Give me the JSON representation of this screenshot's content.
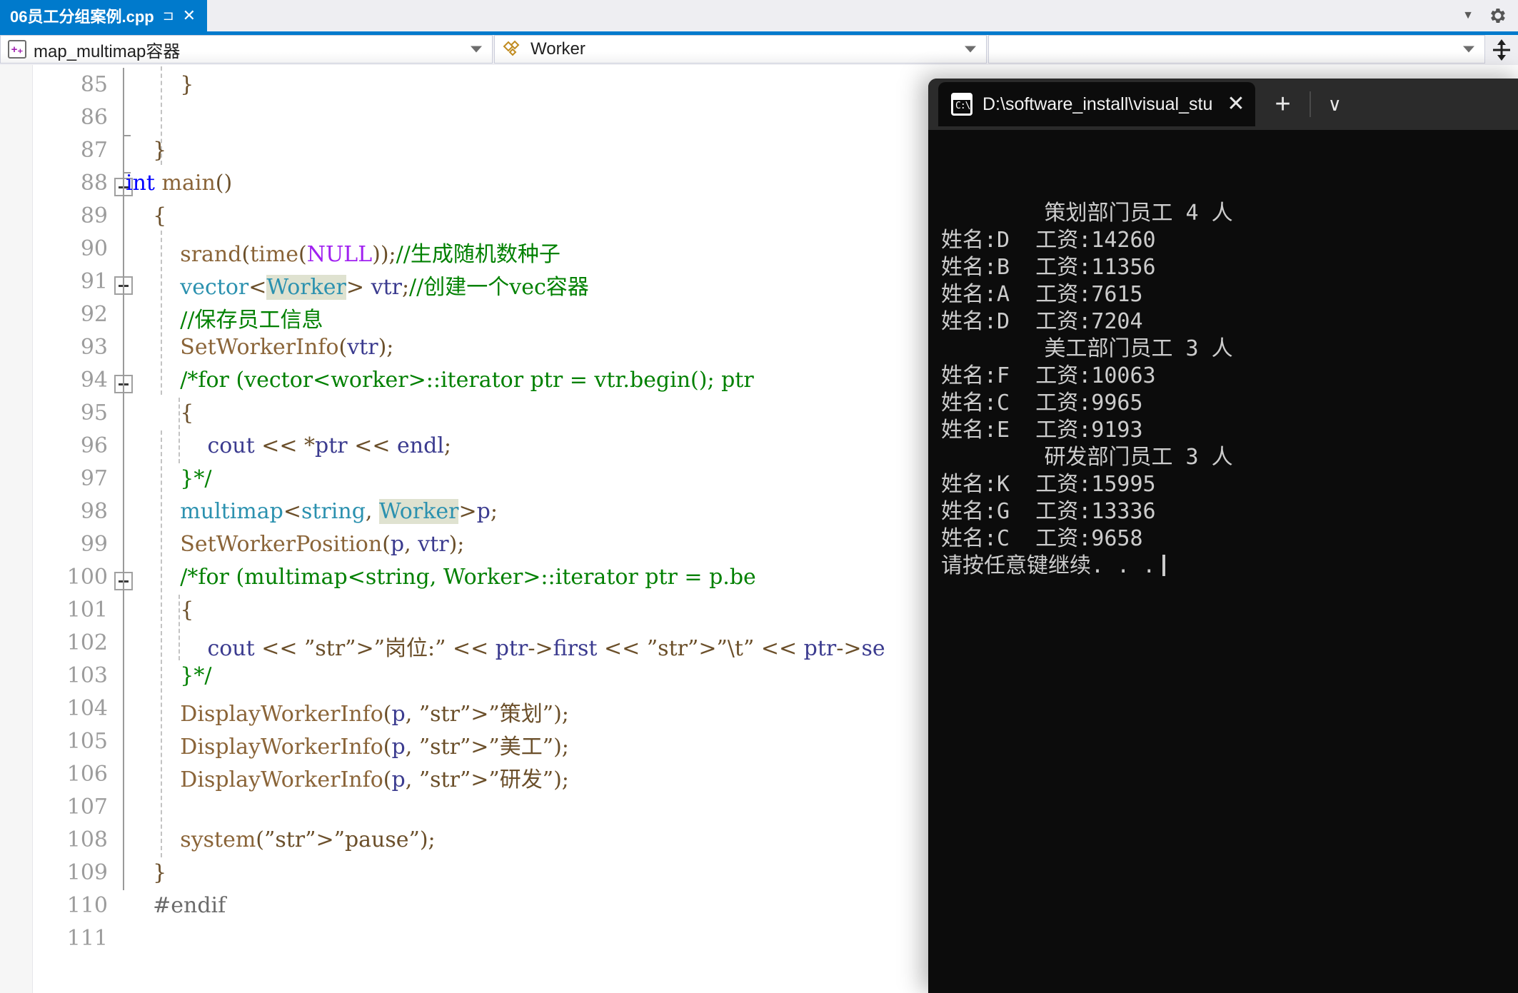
{
  "window": {
    "tab": {
      "title": "06员工分组案例.cpp",
      "pin_glyph": "⊐",
      "close_glyph": "✕"
    },
    "tabstrip_right": {
      "overflow_caret": "▼",
      "settings_icon": "gear-icon"
    }
  },
  "navbar": {
    "scope": {
      "icon": "cpp-file-icon",
      "icon_text": "+₊",
      "value": "map_multimap容器",
      "caret": "▼"
    },
    "member": {
      "icon": "class-icon",
      "value": "Worker",
      "caret": "▼"
    },
    "third": {
      "value": "",
      "caret": "▼"
    },
    "splitter": "split-editor-icon"
  },
  "editor": {
    "first_line": 85,
    "lines": [
      {
        "n": 85,
        "indent": 0,
        "text": "        }"
      },
      {
        "n": 86,
        "indent": 0,
        "text": ""
      },
      {
        "n": 87,
        "indent": 0,
        "text": "    }"
      },
      {
        "n": 88,
        "indent": 0,
        "text": "int main()"
      },
      {
        "n": 89,
        "indent": 0,
        "text": "    {"
      },
      {
        "n": 90,
        "indent": 0,
        "text": "        srand(time(NULL));//生成随机数种子"
      },
      {
        "n": 91,
        "indent": 0,
        "text": "        vector<Worker> vtr;//创建一个vec容器"
      },
      {
        "n": 92,
        "indent": 0,
        "text": "        //保存员工信息"
      },
      {
        "n": 93,
        "indent": 0,
        "text": "        SetWorkerInfo(vtr);"
      },
      {
        "n": 94,
        "indent": 0,
        "text": "        /*for (vector<worker>::iterator ptr = vtr.begin(); ptr"
      },
      {
        "n": 95,
        "indent": 0,
        "text": "        {"
      },
      {
        "n": 96,
        "indent": 0,
        "text": "            cout << *ptr << endl;"
      },
      {
        "n": 97,
        "indent": 0,
        "text": "        }*/"
      },
      {
        "n": 98,
        "indent": 0,
        "text": "        multimap<string, Worker>p;"
      },
      {
        "n": 99,
        "indent": 0,
        "text": "        SetWorkerPosition(p, vtr);"
      },
      {
        "n": 100,
        "indent": 0,
        "text": "        /*for (multimap<string, Worker>::iterator ptr = p.be"
      },
      {
        "n": 101,
        "indent": 0,
        "text": "        {"
      },
      {
        "n": 102,
        "indent": 0,
        "text": "            cout << \"岗位:\" << ptr->first << \"\\t\" << ptr->se"
      },
      {
        "n": 103,
        "indent": 0,
        "text": "        }*/"
      },
      {
        "n": 104,
        "indent": 0,
        "text": "        DisplayWorkerInfo(p, \"策划\");"
      },
      {
        "n": 105,
        "indent": 0,
        "text": "        DisplayWorkerInfo(p, \"美工\");"
      },
      {
        "n": 106,
        "indent": 0,
        "text": "        DisplayWorkerInfo(p, \"研发\");"
      },
      {
        "n": 107,
        "indent": 0,
        "text": ""
      },
      {
        "n": 108,
        "indent": 0,
        "text": "        system(\"pause\");"
      },
      {
        "n": 109,
        "indent": 0,
        "text": "    }"
      },
      {
        "n": 110,
        "indent": 0,
        "text": "    #endif"
      },
      {
        "n": 111,
        "indent": 0,
        "text": ""
      }
    ],
    "colors": {
      "keyword": "#0000ff",
      "type": "#2b91af",
      "macro": "#a020f0",
      "comment": "#008000",
      "string": "#a31515",
      "function": "#8a6438",
      "variable": "#3b3b8f",
      "highlight": "#dfe2d0"
    }
  },
  "console": {
    "tab_title": "D:\\software_install\\visual_stu",
    "close_glyph": "✕",
    "new_tab_glyph": "+",
    "dropdown_glyph": "∨",
    "icon_text": "C:\\",
    "output": [
      "        策划部门员工 4 人",
      "姓名:D  工资:14260",
      "姓名:B  工资:11356",
      "姓名:A  工资:7615",
      "姓名:D  工资:7204",
      "        美工部门员工 3 人",
      "姓名:F  工资:10063",
      "姓名:C  工资:9965",
      "姓名:E  工资:9193",
      "        研发部门员工 3 人",
      "姓名:K  工资:15995",
      "姓名:G  工资:13336",
      "姓名:C  工资:9658",
      "请按任意键继续. . ."
    ]
  }
}
